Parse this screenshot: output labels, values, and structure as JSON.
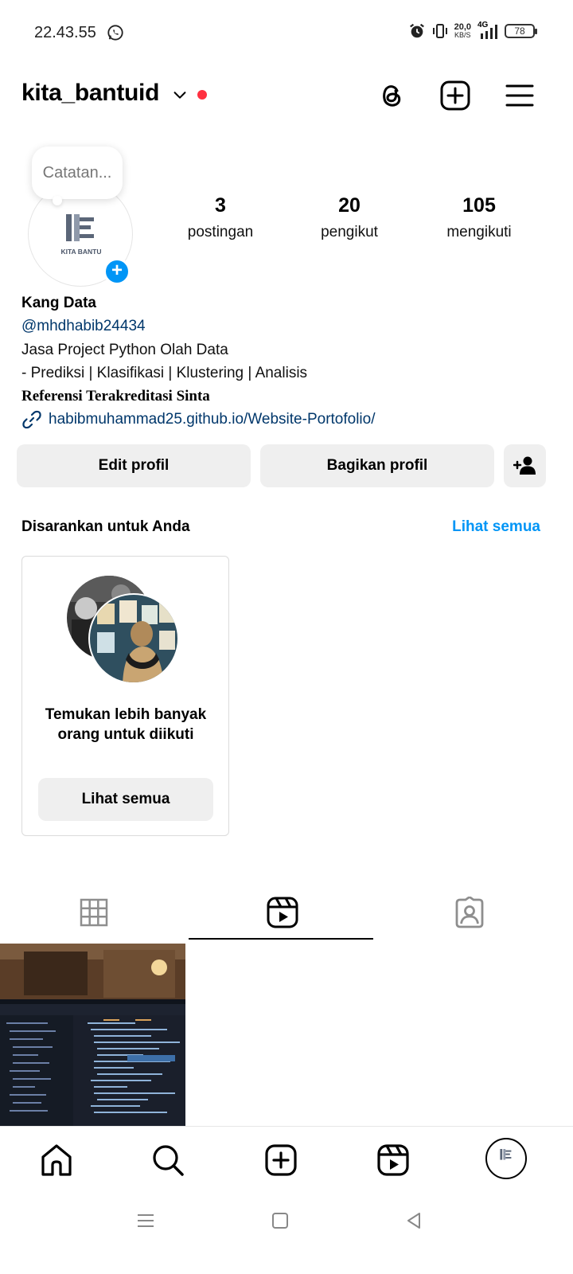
{
  "status_bar": {
    "time": "22.43.55",
    "net_speed_value": "20,0",
    "net_speed_unit": "KB/S",
    "network": "4G",
    "battery": "78"
  },
  "header": {
    "username": "kita_bantuid",
    "icons": [
      "chevron-down-icon",
      "threads-icon",
      "create-icon",
      "menu-icon"
    ]
  },
  "profile": {
    "note_placeholder": "Catatan...",
    "avatar_logo_text": "KITA BANTU",
    "stats": [
      {
        "value": "3",
        "label": "postingan"
      },
      {
        "value": "20",
        "label": "pengikut"
      },
      {
        "value": "105",
        "label": "mengikuti"
      }
    ],
    "bio": {
      "name": "Kang Data",
      "handle": "@mhdhabib24434",
      "line1": "Jasa Project Python Olah Data",
      "line2": "- Prediksi | Klasifikasi | Klustering | Analisis",
      "line3": "Referensi Terakreditasi Sinta",
      "link": "habibmuhammad25.github.io/Website-Portofolio/"
    }
  },
  "actions": {
    "edit_label": "Edit profil",
    "share_label": "Bagikan profil"
  },
  "suggestions": {
    "title": "Disarankan untuk Anda",
    "see_all": "Lihat semua",
    "card_text": "Temukan lebih banyak orang untuk diikuti",
    "card_button": "Lihat semua"
  },
  "tabs": [
    {
      "icon": "grid-icon",
      "active": false
    },
    {
      "icon": "reels-icon",
      "active": true
    },
    {
      "icon": "tagged-icon",
      "active": false
    }
  ],
  "bottom_nav": [
    "home-icon",
    "search-icon",
    "create-icon",
    "reels-icon",
    "profile-avatar"
  ],
  "colors": {
    "accent": "#0095f6",
    "link": "#00376b",
    "notification_dot": "#ff3040",
    "button_bg": "#efefef"
  }
}
